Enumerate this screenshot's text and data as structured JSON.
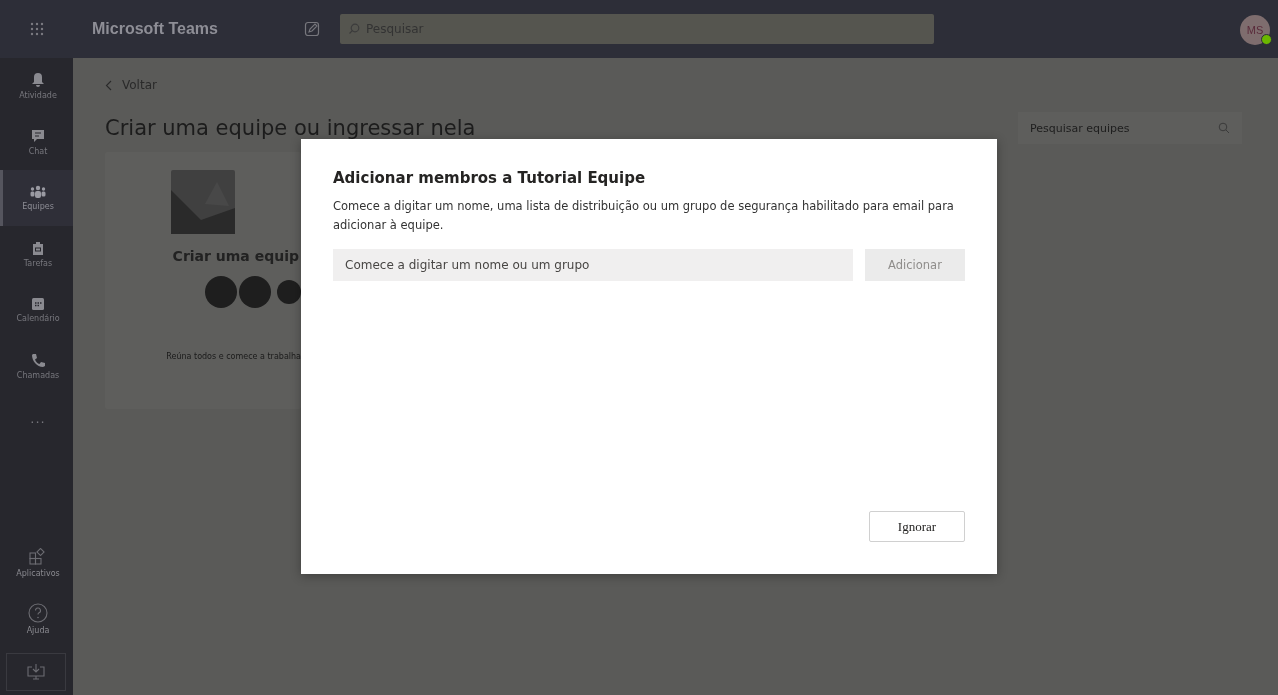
{
  "app": {
    "title": "Microsoft Teams",
    "search_placeholder": "Pesquisar",
    "avatar": {
      "initials": "MS"
    }
  },
  "nav": [
    {
      "label": "Atividade",
      "selected": false
    },
    {
      "label": "Chat",
      "selected": false
    },
    {
      "label": "Equipes",
      "selected": true
    },
    {
      "label": "Tarefas",
      "selected": false
    },
    {
      "label": "Calendário",
      "selected": false
    },
    {
      "label": "Chamadas",
      "selected": false
    },
    {
      "label": "···",
      "selected": false
    }
  ],
  "nav_bottom": [
    {
      "label": "Aplicativos",
      "selected": false
    },
    {
      "label": "Ajuda",
      "selected": false
    }
  ],
  "page": {
    "back": "Voltar",
    "title": "Criar uma equipe ou ingressar nela",
    "search_placeholder": "Pesquisar equipes",
    "card": {
      "title": "Criar uma equip",
      "text": "Reúna todos e comece a trabalha"
    }
  },
  "dialog": {
    "title": "Adicionar membros a Tutorial Equipe",
    "description": "Comece a digitar um nome, uma lista de distribuição ou um grupo de segurança habilitado para email para adicionar à equipe.",
    "input_placeholder": "Comece a digitar um nome ou um grupo",
    "add_button": {
      "label": "Adicionar",
      "disabled": true
    },
    "skip_button": "Ignorar"
  }
}
